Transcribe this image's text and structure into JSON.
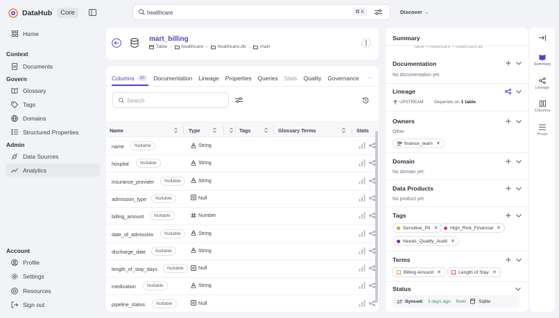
{
  "app": {
    "name": "DataHub",
    "badge": "Core"
  },
  "nav": {
    "home": "Home",
    "context_header": "Context",
    "documents": "Documents",
    "govern_header": "Govern",
    "glossary": "Glossary",
    "tags": "Tags",
    "domains": "Domains",
    "structured_properties": "Structured Properties",
    "admin_header": "Admin",
    "data_sources": "Data Sources",
    "analytics": "Analytics",
    "account_header": "Account",
    "profile": "Profile",
    "settings": "Settings",
    "resources": "Resources",
    "sign_out": "Sign out"
  },
  "search": {
    "value": "healthcare",
    "shortcut": "⌘ K"
  },
  "header": {
    "discover": "Discover →"
  },
  "entity": {
    "name": "mart_billing",
    "type": "Table",
    "breadcrumb": [
      "healthcare",
      "healthcare.db",
      "main"
    ]
  },
  "tabs": {
    "columns": "Columns",
    "columns_count": "10",
    "documentation": "Documentation",
    "lineage": "Lineage",
    "properties": "Properties",
    "queries": "Queries",
    "stats": "Stats",
    "quality": "Quality",
    "governance": "Governance",
    "more": "···"
  },
  "table": {
    "search_placeholder": "Search",
    "headers": {
      "name": "Name",
      "type": "Type",
      "tags": "Tags",
      "glossary": "Glossary Terms",
      "stats": "Stats"
    },
    "rows": [
      {
        "name": "name",
        "badge": "Nullable",
        "type": "String",
        "type_icon": "string-type-icon"
      },
      {
        "name": "hospital",
        "badge": "Nullable",
        "type": "String",
        "type_icon": "string-type-icon"
      },
      {
        "name": "insurance_provider",
        "badge": "Nullable",
        "type": "String",
        "type_icon": "string-type-icon"
      },
      {
        "name": "admission_type",
        "badge": "Nullable",
        "type": "Null",
        "type_icon": "null-type-icon"
      },
      {
        "name": "billing_amount",
        "badge": "Nullable",
        "type": "Number",
        "type_icon": "number-type-icon"
      },
      {
        "name": "date_of_admission",
        "badge": "Nullable",
        "type": "String",
        "type_icon": "string-type-icon"
      },
      {
        "name": "discharge_date",
        "badge": "Nullable",
        "type": "String",
        "type_icon": "string-type-icon"
      },
      {
        "name": "length_of_stay_days",
        "badge": "Nullable",
        "type": "Null",
        "type_icon": "null-type-icon"
      },
      {
        "name": "medication",
        "badge": "Nullable",
        "type": "String",
        "type_icon": "string-type-icon"
      },
      {
        "name": "pipeline_status",
        "badge": "Nullable",
        "type": "Null",
        "type_icon": "null-type-icon"
      }
    ]
  },
  "summary": {
    "title": "Summary",
    "clipped_breadcrumb": "Table  >  healthcare  >  healthcare.db",
    "documentation": {
      "title": "Documentation",
      "empty": "No documentation yet."
    },
    "lineage": {
      "title": "Lineage",
      "upstream": "UPSTREAM",
      "depends_prefix": "Depends on",
      "depends_count": "1 table"
    },
    "owners": {
      "title": "Owners",
      "group": "Other",
      "owner": "finance_team"
    },
    "domain": {
      "title": "Domain",
      "empty": "No domain yet."
    },
    "data_products": {
      "title": "Data Products",
      "empty": "No product yet."
    },
    "tags": {
      "title": "Tags",
      "items": [
        {
          "label": "Sensitive_PII",
          "color": "#c9a227"
        },
        {
          "label": "High_Risk_Financial",
          "color": "#d6338a"
        },
        {
          "label": "Needs_Quality_Audit",
          "color": "#6f2da8"
        }
      ]
    },
    "terms": {
      "title": "Terms",
      "items": [
        "Billing Amount",
        "Length of Stay"
      ]
    },
    "status": {
      "title": "Status",
      "synced_label": "Synced:",
      "synced_ago": "3 days ago",
      "from": "from",
      "source": "Sqlite"
    }
  },
  "rail": {
    "summary": "Summary",
    "lineage": "Lineage",
    "columns": "Columns",
    "props": "Props"
  },
  "colors": {
    "accent": "#5b3fc7",
    "green": "#2e9e5b"
  }
}
